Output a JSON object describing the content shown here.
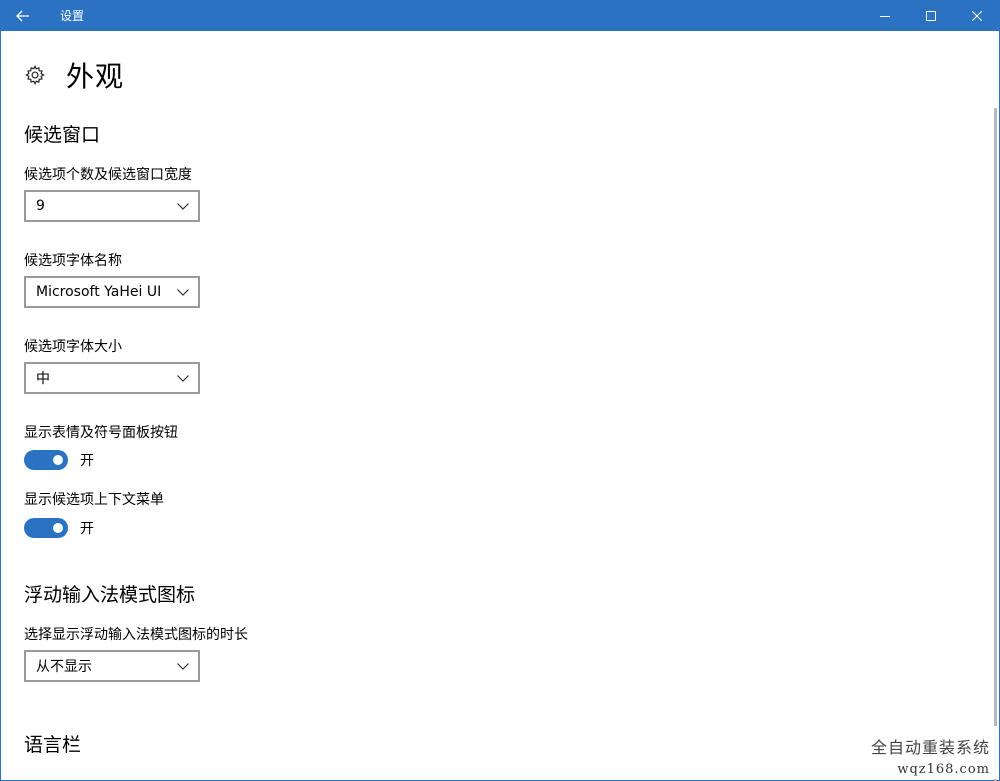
{
  "window": {
    "title": "设置",
    "accent_color": "#2b73c2",
    "icons": {
      "back": "back-arrow-icon",
      "minimize": "minimize-icon",
      "maximize": "maximize-icon",
      "close": "close-icon"
    }
  },
  "page": {
    "title": "外观",
    "icon": "gear-icon"
  },
  "candidate_window": {
    "section_title": "候选窗口",
    "count_width": {
      "label": "候选项个数及候选窗口宽度",
      "value": "9"
    },
    "font_name": {
      "label": "候选项字体名称",
      "value": "Microsoft YaHei UI"
    },
    "font_size": {
      "label": "候选项字体大小",
      "value": "中"
    },
    "emoji_button": {
      "label": "显示表情及符号面板按钮",
      "state": "开",
      "on": true
    },
    "context_menu": {
      "label": "显示候选项上下文菜单",
      "state": "开",
      "on": true
    }
  },
  "floating_icon": {
    "section_title": "浮动输入法模式图标",
    "duration": {
      "label": "选择显示浮动输入法模式图标的时长",
      "value": "从不显示"
    }
  },
  "language_bar": {
    "section_title": "语言栏"
  },
  "watermark": {
    "name": "全自动重装系统",
    "url": "wqz168.com"
  }
}
